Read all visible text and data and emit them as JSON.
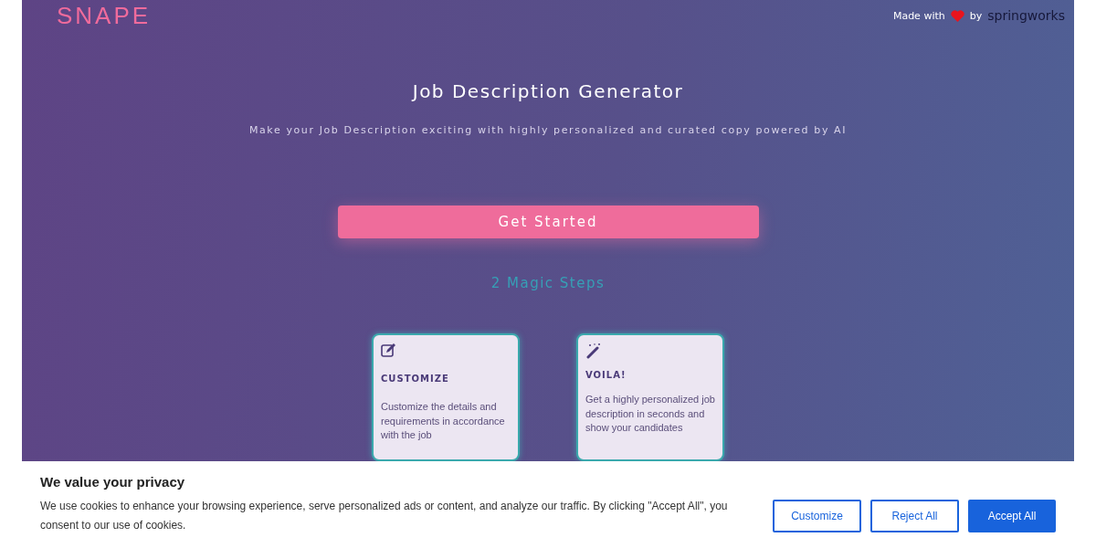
{
  "header": {
    "logo": "SNAPE",
    "made_with": "Made with",
    "by": "by",
    "brand": "springworks"
  },
  "hero": {
    "title": "Job Description Generator",
    "subtitle": "Make your Job Description exciting with highly personalized and curated copy powered by AI",
    "cta": "Get Started"
  },
  "steps": {
    "title": "2 Magic Steps",
    "cards": [
      {
        "kind": "edit",
        "heading": "CUSTOMIZE",
        "body": "Customize the details and requirements in accordance with the job"
      },
      {
        "kind": "wand",
        "heading": "VOILA!",
        "body": "Get a highly personalized job description in seconds and show your candidates"
      }
    ]
  },
  "cookie_banner": {
    "title": "We value your privacy",
    "text": "We use cookies to enhance your browsing experience, serve personalized ads or content, and analyze our traffic. By clicking \"Accept All\", you consent to our use of cookies.",
    "buttons": [
      {
        "label": "Customize",
        "kind": "outline"
      },
      {
        "label": "Reject All",
        "kind": "outline"
      },
      {
        "label": "Accept All",
        "kind": "primary"
      }
    ]
  }
}
